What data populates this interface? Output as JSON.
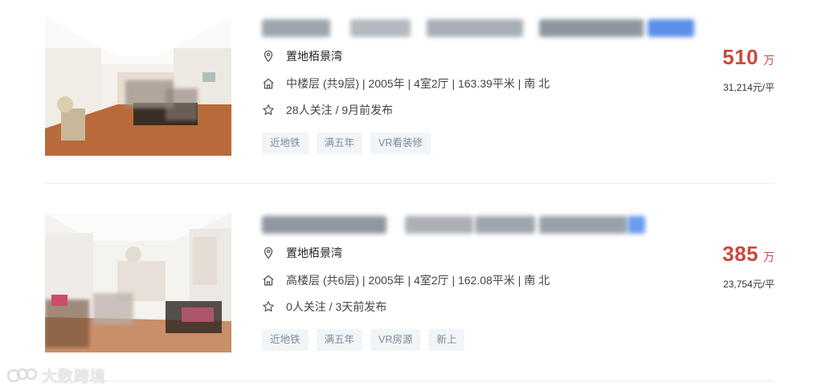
{
  "listings": [
    {
      "location": "置地栢景湾",
      "info": "中楼层 (共9层) | 2005年 | 4室2厅 | 163.39平米 | 南 北",
      "follow": "28人关注 / 9月前发布",
      "tags": [
        "近地铁",
        "满五年",
        "VR看装修"
      ],
      "price": "510",
      "price_unit": "万",
      "unit_price": "31,214元/平"
    },
    {
      "location": "置地栢景湾",
      "info": "高楼层 (共6层) | 2005年 | 4室2厅 | 162.08平米 | 南 北",
      "follow": "0人关注 / 3天前发布",
      "tags": [
        "近地铁",
        "满五年",
        "VR房源",
        "新上"
      ],
      "price": "385",
      "price_unit": "万",
      "unit_price": "23,754元/平"
    }
  ],
  "watermark": "大数跨境",
  "icons": {
    "location": "location-pin-icon",
    "house": "house-icon",
    "star": "star-icon"
  },
  "colors": {
    "price": "#c94a3c",
    "tag_bg": "#f2f5f7",
    "tag_text": "#7a8a99"
  }
}
